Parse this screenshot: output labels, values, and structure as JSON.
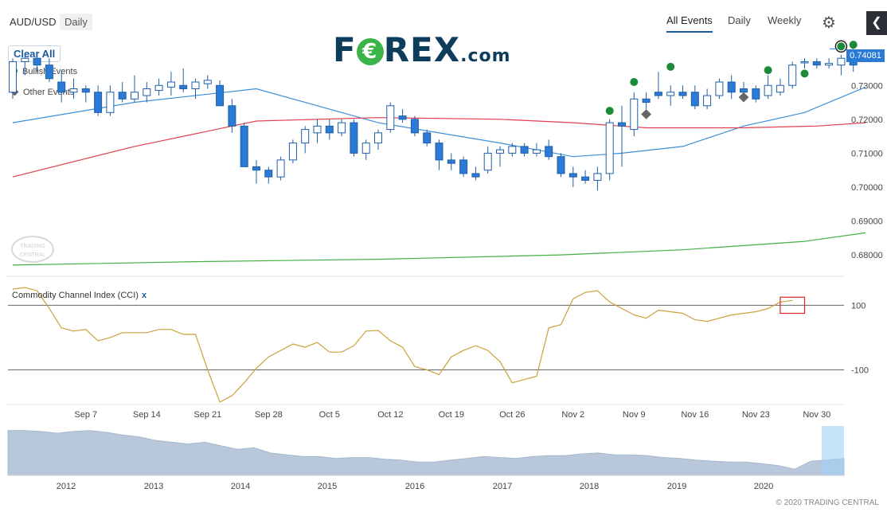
{
  "header": {
    "symbol": "AUD/USD",
    "period": "Daily",
    "logo_text": "FOREX",
    "logo_suffix": ".com",
    "tabs": [
      "All Events",
      "Daily",
      "Weekly"
    ],
    "active_tab": "All Events",
    "settings_icon": "gear-icon",
    "collapse_icon": "chevron-left-icon"
  },
  "controls": {
    "clear_all": "Clear All",
    "legend": [
      {
        "label": "Bullish Events",
        "icon": "green-dot-icon",
        "color": "#1d8a3a"
      },
      {
        "label": "Other Events",
        "icon": "gray-diamond-icon",
        "color": "#666666"
      }
    ]
  },
  "watermark": {
    "line1": "TRADING",
    "line2": "CENTRAL"
  },
  "copyright": "© 2020 TRADING CENTRAL",
  "colors": {
    "bull_candle": "#ffffff",
    "bear_candle": "#2a7ad6",
    "candle_border": "#1f5fa8",
    "ma_fast": "#3b8fd8",
    "ma_mid": "#e04050",
    "ma_slow": "#44b044",
    "cci": "#c9a23a",
    "navigator_fill": "#b8c8da",
    "highlight": "#d9252b"
  },
  "chart_data": [
    {
      "type": "candlestick",
      "title": "AUD/USD Daily",
      "last_price_label": "0.74081",
      "y_ticks": [
        "0.73000",
        "0.72000",
        "0.71000",
        "0.70000",
        "0.69000",
        "0.68000"
      ],
      "ylim": [
        0.6765,
        0.7458
      ],
      "x_ticks": [
        "Sep 7",
        "Sep 14",
        "Sep 21",
        "Sep 28",
        "Oct 5",
        "Oct 12",
        "Oct 19",
        "Oct 26",
        "Nov 2",
        "Nov 9",
        "Nov 16",
        "Nov 23",
        "Nov 30"
      ],
      "x_tick_index": [
        6,
        11,
        16,
        21,
        26,
        31,
        36,
        41,
        46,
        51,
        56,
        61,
        66
      ],
      "ohlc": [
        [
          0.728,
          0.738,
          0.726,
          0.737
        ],
        [
          0.737,
          0.7395,
          0.733,
          0.738
        ],
        [
          0.738,
          0.74,
          0.734,
          0.736
        ],
        [
          0.736,
          0.738,
          0.731,
          0.732
        ],
        [
          0.731,
          0.734,
          0.725,
          0.728
        ],
        [
          0.728,
          0.732,
          0.726,
          0.729
        ],
        [
          0.729,
          0.73,
          0.725,
          0.728
        ],
        [
          0.728,
          0.73,
          0.721,
          0.722
        ],
        [
          0.722,
          0.73,
          0.721,
          0.728
        ],
        [
          0.728,
          0.731,
          0.725,
          0.726
        ],
        [
          0.726,
          0.733,
          0.725,
          0.728
        ],
        [
          0.727,
          0.731,
          0.725,
          0.729
        ],
        [
          0.7285,
          0.732,
          0.727,
          0.73
        ],
        [
          0.7295,
          0.734,
          0.727,
          0.731
        ],
        [
          0.73,
          0.735,
          0.728,
          0.729
        ],
        [
          0.729,
          0.732,
          0.726,
          0.731
        ],
        [
          0.7305,
          0.733,
          0.729,
          0.7315
        ],
        [
          0.73,
          0.7315,
          0.724,
          0.724
        ],
        [
          0.724,
          0.726,
          0.716,
          0.718
        ],
        [
          0.718,
          0.719,
          0.706,
          0.706
        ],
        [
          0.706,
          0.708,
          0.701,
          0.705
        ],
        [
          0.705,
          0.706,
          0.701,
          0.703
        ],
        [
          0.703,
          0.709,
          0.702,
          0.708
        ],
        [
          0.708,
          0.714,
          0.707,
          0.713
        ],
        [
          0.713,
          0.718,
          0.71,
          0.717
        ],
        [
          0.716,
          0.72,
          0.713,
          0.718
        ],
        [
          0.718,
          0.72,
          0.714,
          0.716
        ],
        [
          0.716,
          0.72,
          0.715,
          0.719
        ],
        [
          0.719,
          0.72,
          0.709,
          0.71
        ],
        [
          0.71,
          0.714,
          0.708,
          0.713
        ],
        [
          0.713,
          0.717,
          0.711,
          0.716
        ],
        [
          0.717,
          0.725,
          0.716,
          0.724
        ],
        [
          0.721,
          0.723,
          0.719,
          0.72
        ],
        [
          0.72,
          0.721,
          0.715,
          0.716
        ],
        [
          0.716,
          0.717,
          0.712,
          0.713
        ],
        [
          0.713,
          0.714,
          0.705,
          0.708
        ],
        [
          0.708,
          0.71,
          0.705,
          0.707
        ],
        [
          0.708,
          0.709,
          0.703,
          0.704
        ],
        [
          0.704,
          0.706,
          0.702,
          0.703
        ],
        [
          0.705,
          0.712,
          0.704,
          0.71
        ],
        [
          0.71,
          0.712,
          0.706,
          0.711
        ],
        [
          0.71,
          0.713,
          0.709,
          0.712
        ],
        [
          0.712,
          0.713,
          0.709,
          0.71
        ],
        [
          0.71,
          0.713,
          0.709,
          0.711
        ],
        [
          0.712,
          0.714,
          0.708,
          0.709
        ],
        [
          0.709,
          0.71,
          0.703,
          0.704
        ],
        [
          0.704,
          0.706,
          0.7,
          0.703
        ],
        [
          0.703,
          0.705,
          0.701,
          0.702
        ],
        [
          0.702,
          0.706,
          0.699,
          0.704
        ],
        [
          0.704,
          0.72,
          0.702,
          0.719
        ],
        [
          0.719,
          0.724,
          0.706,
          0.718
        ],
        [
          0.717,
          0.728,
          0.715,
          0.726
        ],
        [
          0.726,
          0.728,
          0.723,
          0.725
        ],
        [
          0.728,
          0.734,
          0.726,
          0.727
        ],
        [
          0.727,
          0.73,
          0.724,
          0.728
        ],
        [
          0.728,
          0.73,
          0.726,
          0.727
        ],
        [
          0.728,
          0.73,
          0.723,
          0.724
        ],
        [
          0.724,
          0.729,
          0.723,
          0.727
        ],
        [
          0.727,
          0.732,
          0.726,
          0.731
        ],
        [
          0.731,
          0.733,
          0.726,
          0.728
        ],
        [
          0.729,
          0.731,
          0.726,
          0.728
        ],
        [
          0.729,
          0.73,
          0.725,
          0.726
        ],
        [
          0.727,
          0.733,
          0.726,
          0.73
        ],
        [
          0.728,
          0.732,
          0.727,
          0.73
        ],
        [
          0.73,
          0.737,
          0.729,
          0.736
        ],
        [
          0.737,
          0.738,
          0.735,
          0.737
        ],
        [
          0.737,
          0.738,
          0.735,
          0.736
        ],
        [
          0.736,
          0.738,
          0.735,
          0.7365
        ],
        [
          0.736,
          0.739,
          0.733,
          0.738
        ],
        [
          0.74,
          0.741,
          0.734,
          0.736
        ]
      ],
      "moving_averages": [
        {
          "points": [
            [
              0,
              0.719
            ],
            [
              10,
              0.725
            ],
            [
              20,
              0.729
            ],
            [
              25,
              0.724
            ],
            [
              30,
              0.719
            ],
            [
              40,
              0.713
            ],
            [
              46,
              0.709
            ],
            [
              50,
              0.71
            ],
            [
              55,
              0.712
            ],
            [
              60,
              0.718
            ],
            [
              65,
              0.722
            ],
            [
              70,
              0.7295
            ]
          ]
        },
        {
          "points": [
            [
              0,
              0.703
            ],
            [
              10,
              0.712
            ],
            [
              20,
              0.7195
            ],
            [
              30,
              0.7205
            ],
            [
              40,
              0.72
            ],
            [
              46,
              0.719
            ],
            [
              52,
              0.7175
            ],
            [
              60,
              0.7175
            ],
            [
              66,
              0.718
            ],
            [
              70,
              0.719
            ]
          ]
        },
        {
          "points": [
            [
              0,
              0.677
            ],
            [
              15,
              0.678
            ],
            [
              30,
              0.6787
            ],
            [
              45,
              0.68
            ],
            [
              55,
              0.6815
            ],
            [
              65,
              0.684
            ],
            [
              70,
              0.6865
            ]
          ]
        }
      ],
      "events": [
        {
          "type": "bullish",
          "index": 49,
          "value": 0.7225
        },
        {
          "type": "bullish",
          "index": 51,
          "value": 0.731
        },
        {
          "type": "bullish",
          "index": 54,
          "value": 0.7355
        },
        {
          "type": "bullish",
          "index": 62,
          "value": 0.7345
        },
        {
          "type": "bullish",
          "index": 65,
          "value": 0.7335
        },
        {
          "type": "bullish",
          "index": 68,
          "value": 0.7415
        },
        {
          "type": "bullish",
          "index": 69,
          "value": 0.742
        },
        {
          "type": "other",
          "index": 52,
          "value": 0.7215
        },
        {
          "type": "other",
          "index": 60,
          "value": 0.7265
        }
      ]
    },
    {
      "type": "line",
      "title": "Commodity Channel Index (CCI)",
      "close_label": "x",
      "y_ticks": [
        "100",
        "-100"
      ],
      "y_tick_values": [
        100,
        -100
      ],
      "ylim": [
        -200,
        170
      ],
      "values": [
        150,
        155,
        145,
        90,
        30,
        20,
        25,
        -10,
        0,
        15,
        15,
        15,
        25,
        25,
        10,
        10,
        -100,
        -200,
        -180,
        -140,
        -95,
        -60,
        -40,
        -20,
        -30,
        -15,
        -45,
        -45,
        -25,
        20,
        22,
        -10,
        -30,
        -90,
        -100,
        -115,
        -60,
        -40,
        -25,
        -40,
        -75,
        -140,
        -130,
        -120,
        30,
        40,
        120,
        140,
        145,
        110,
        90,
        70,
        60,
        85,
        80,
        75,
        55,
        50,
        60,
        70,
        75,
        80,
        90,
        110,
        115
      ],
      "highlight_range": [
        63,
        65
      ]
    }
  ],
  "navigator": {
    "years": [
      "2012",
      "2013",
      "2014",
      "2015",
      "2016",
      "2017",
      "2018",
      "2019",
      "2020"
    ],
    "values": [
      1.05,
      1.05,
      1.04,
      1.02,
      1.04,
      1.05,
      1.03,
      1.0,
      0.98,
      0.94,
      0.92,
      0.9,
      0.92,
      0.88,
      0.84,
      0.86,
      0.8,
      0.78,
      0.76,
      0.76,
      0.74,
      0.75,
      0.75,
      0.73,
      0.72,
      0.7,
      0.7,
      0.72,
      0.74,
      0.76,
      0.75,
      0.74,
      0.76,
      0.77,
      0.77,
      0.79,
      0.8,
      0.78,
      0.78,
      0.77,
      0.75,
      0.74,
      0.72,
      0.71,
      0.7,
      0.7,
      0.68,
      0.66,
      0.62,
      0.71,
      0.72,
      0.74
    ],
    "ylim": [
      0.55,
      1.1
    ]
  }
}
